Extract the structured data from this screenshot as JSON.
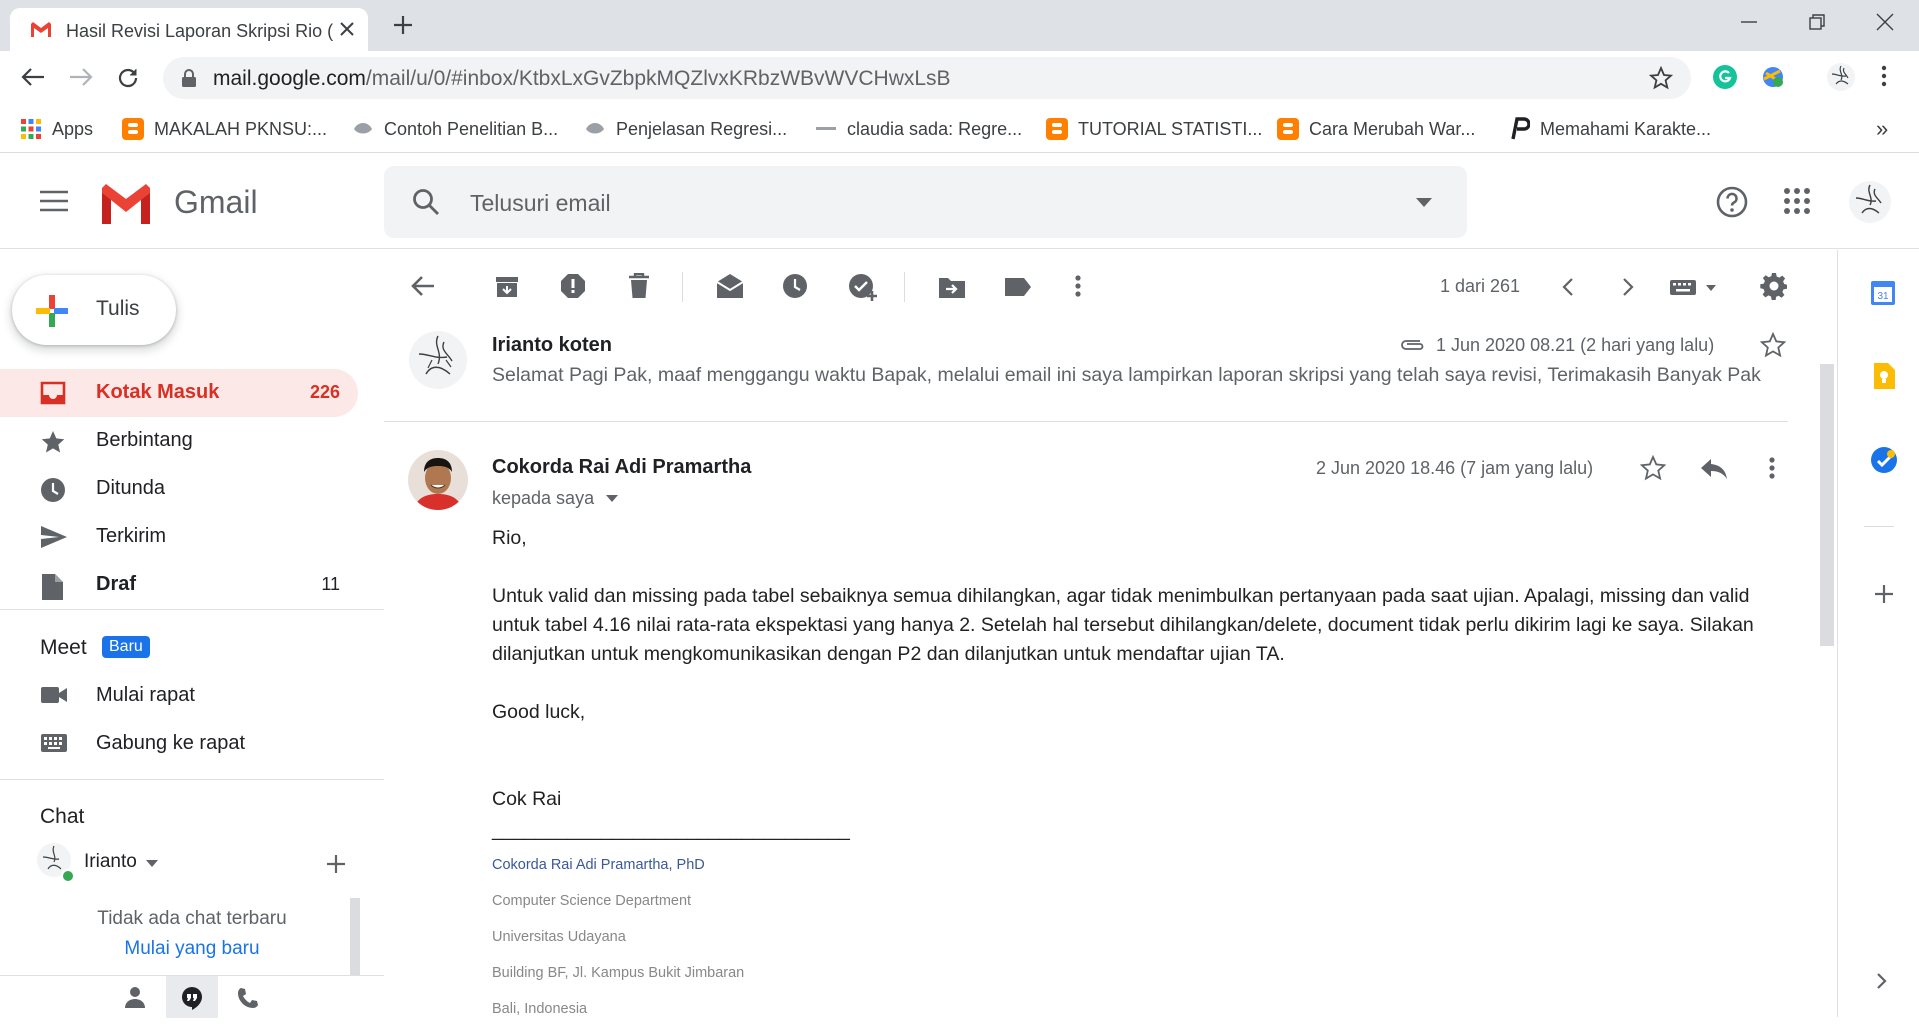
{
  "browser": {
    "tab_title": "Hasil Revisi Laporan Skripsi Rio (D",
    "url_host": "mail.google.com",
    "url_path": "/mail/u/0/#inbox/KtbxLxGvZbpkMQZlvxKRbzWBvWVCHwxLsB",
    "bookmarks": [
      {
        "label": "Apps",
        "icon": "apps-grid-icon"
      },
      {
        "label": "MAKALAH PKNSU:...",
        "icon": "blogger-icon"
      },
      {
        "label": "Contoh Penelitian B...",
        "icon": "site-icon"
      },
      {
        "label": "Penjelasan Regresi...",
        "icon": "site-icon"
      },
      {
        "label": "claudia sada: Regre...",
        "icon": "site-icon"
      },
      {
        "label": "TUTORIAL STATISTI...",
        "icon": "blogger-icon"
      },
      {
        "label": "Cara Merubah War...",
        "icon": "blogger-icon"
      },
      {
        "label": "Memahami Karakte...",
        "icon": "p-icon"
      }
    ],
    "more_bookmarks": "»"
  },
  "gmail": {
    "logo_text": "Gmail",
    "search_placeholder": "Telusuri email",
    "compose_label": "Tulis",
    "nav": [
      {
        "label": "Kotak Masuk",
        "count": "226",
        "icon": "inbox-icon"
      },
      {
        "label": "Berbintang",
        "count": "",
        "icon": "star-icon"
      },
      {
        "label": "Ditunda",
        "count": "",
        "icon": "clock-icon"
      },
      {
        "label": "Terkirim",
        "count": "",
        "icon": "send-icon"
      },
      {
        "label": "Draf",
        "count": "11",
        "icon": "draft-icon"
      }
    ],
    "meet": {
      "title": "Meet",
      "badge": "Baru",
      "items": [
        {
          "label": "Mulai rapat",
          "icon": "video-icon"
        },
        {
          "label": "Gabung ke rapat",
          "icon": "keyboard-icon"
        }
      ]
    },
    "chat": {
      "title": "Chat",
      "user": "Irianto",
      "empty_text": "Tidak ada chat terbaru",
      "start_link": "Mulai yang baru"
    },
    "pager": "1 dari 261"
  },
  "thread": {
    "message1": {
      "sender": "Irianto koten",
      "date": "1 Jun 2020 08.21 (2 hari yang lalu)",
      "snippet": "Selamat Pagi Pak, maaf menggangu waktu Bapak, melalui email ini saya lampirkan laporan skripsi yang telah saya revisi, Terimakasih Banyak Pak"
    },
    "message2": {
      "sender": "Cokorda Rai Adi Pramartha",
      "date": "2 Jun 2020 18.46 (7 jam yang lalu)",
      "to": "kepada saya",
      "greeting": "Rio,",
      "paragraph": "Untuk valid dan missing pada tabel sebaiknya semua dihilangkan, agar tidak menimbulkan pertanyaan pada saat ujian.  Apalagi, missing dan valid untuk tabel 4.16 nilai rata-rata ekspektasi yang hanya 2.  Setelah hal tersebut dihilangkan/delete, document tidak perlu dikirim lagi ke saya.  Silakan dilanjutkan untuk mengkomunikasikan dengan P2 dan dilanjutkan untuk mendaftar ujian TA.",
      "closing": "Good luck,",
      "signoff": "Cok Rai",
      "rule": "_________________________________",
      "sig_name": "Cokorda Rai Adi Pramartha, PhD",
      "sig_dept": "Computer Science Department",
      "sig_univ": "Universitas Udayana",
      "sig_addr": "Building BF, Jl. Kampus Bukit Jimbaran",
      "sig_city": "Bali, Indonesia"
    }
  },
  "colors": {
    "gmail_red": "#d93025",
    "blue": "#1a73e8",
    "grey_icon": "#5f6368"
  }
}
